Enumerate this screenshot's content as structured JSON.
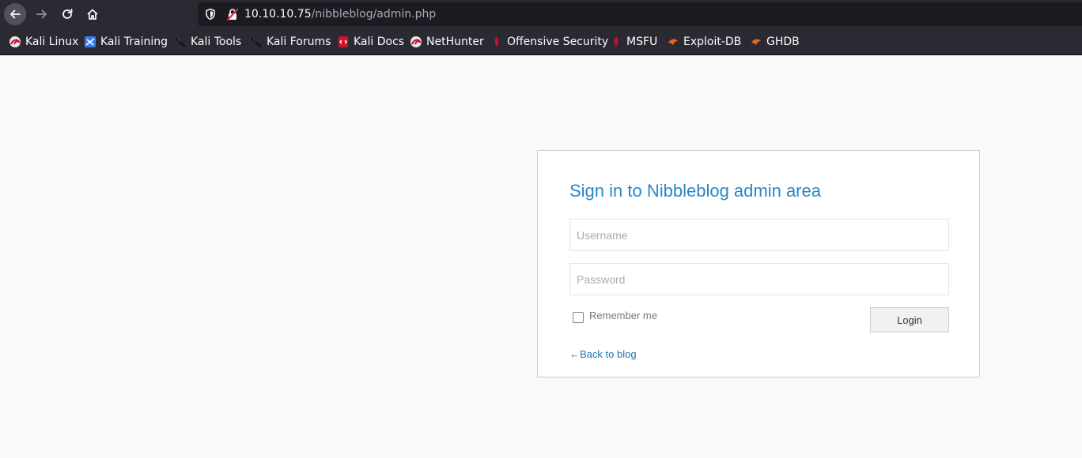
{
  "browser": {
    "url_host": "10.10.10.75",
    "url_path": "/nibbleblog/admin.php",
    "bookmarks": [
      {
        "label": "Kali Linux",
        "icon": "kali-dragon-icon"
      },
      {
        "label": "Kali Training",
        "icon": "kali-training-icon"
      },
      {
        "label": "Kali Tools",
        "icon": "kali-tools-icon"
      },
      {
        "label": "Kali Forums",
        "icon": "kali-forums-icon"
      },
      {
        "label": "Kali Docs",
        "icon": "kali-docs-icon"
      },
      {
        "label": "NetHunter",
        "icon": "nethunter-icon"
      },
      {
        "label": "Offensive Security",
        "icon": "offsec-icon"
      },
      {
        "label": "MSFU",
        "icon": "msfu-icon"
      },
      {
        "label": "Exploit-DB",
        "icon": "exploit-db-icon"
      },
      {
        "label": "GHDB",
        "icon": "ghdb-icon"
      }
    ]
  },
  "login": {
    "title": "Sign in to Nibbleblog admin area",
    "username_placeholder": "Username",
    "password_placeholder": "Password",
    "remember_label": "Remember me",
    "login_label": "Login",
    "back_link": "←Back to blog"
  },
  "colors": {
    "toolbar_bg": "#2b2a33",
    "title_blue": "#2a87c7",
    "link_blue": "#1a76b9",
    "page_bg": "#f9f9f9"
  }
}
